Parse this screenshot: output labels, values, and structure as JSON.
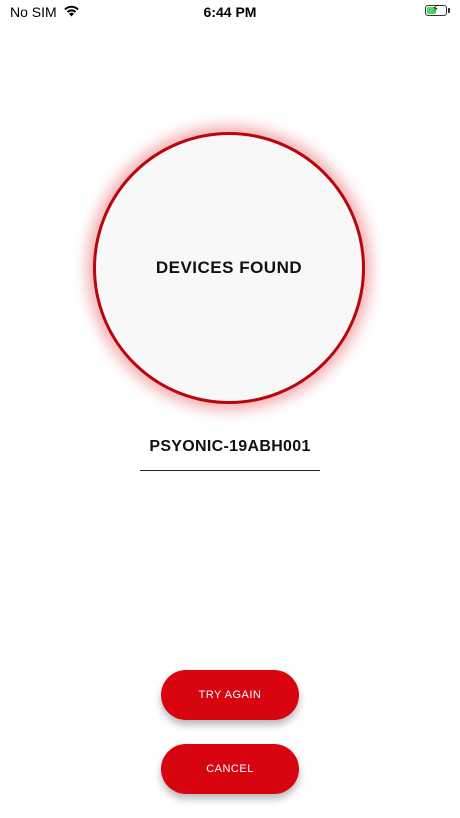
{
  "status_bar": {
    "carrier": "No SIM",
    "time": "6:44 PM",
    "battery_level": 0.55,
    "battery_color": "#4cd964"
  },
  "scan": {
    "title": "DEVICES FOUND",
    "ring_color": "#b8060c"
  },
  "device": {
    "name": "PSYONIC-19ABH001"
  },
  "actions": {
    "try_again_label": "TRY AGAIN",
    "cancel_label": "CANCEL",
    "button_color": "#d80510"
  }
}
